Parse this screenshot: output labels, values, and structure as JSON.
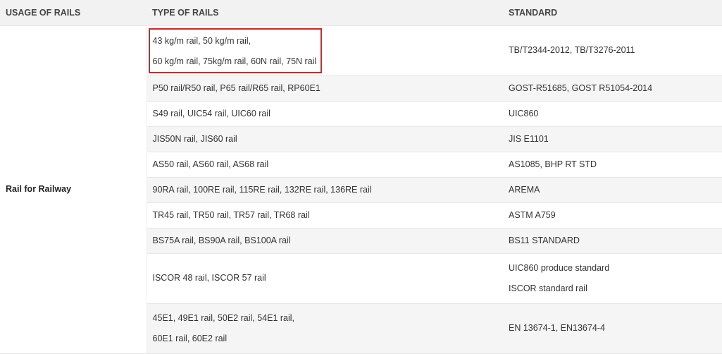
{
  "headers": {
    "usage": "USAGE OF RAILS",
    "type": "TYPE OF RAILS",
    "standard": "STANDARD"
  },
  "usage_label": "Rail for Railway",
  "highlight_color": "#e02020",
  "rows": [
    {
      "type": [
        "43 kg/m rail, 50 kg/m rail,",
        "60 kg/m rail, 75kg/m rail, 60N rail, 75N rail"
      ],
      "standard": [
        "TB/T2344-2012, TB/T3276-2011"
      ]
    },
    {
      "type": [
        "P50 rail/R50 rail, P65 rail/R65 rail, RP60E1"
      ],
      "standard": [
        "GOST-R51685, GOST R51054-2014"
      ]
    },
    {
      "type": [
        "S49 rail, UIC54 rail, UIC60 rail"
      ],
      "standard": [
        "UIC860"
      ]
    },
    {
      "type": [
        "JIS50N rail, JIS60 rail"
      ],
      "standard": [
        "JIS E1101"
      ]
    },
    {
      "type": [
        "AS50 rail, AS60 rail, AS68 rail"
      ],
      "standard": [
        "AS1085, BHP RT STD"
      ]
    },
    {
      "type": [
        "90RA rail, 100RE rail, 115RE rail, 132RE rail, 136RE rail"
      ],
      "standard": [
        "AREMA"
      ]
    },
    {
      "type": [
        "TR45 rail, TR50 rail, TR57 rail, TR68 rail"
      ],
      "standard": [
        "ASTM A759"
      ]
    },
    {
      "type": [
        "BS75A rail, BS90A rail, BS100A rail"
      ],
      "standard": [
        "BS11 STANDARD"
      ]
    },
    {
      "type": [
        "ISCOR 48 rail, ISCOR 57 rail"
      ],
      "standard": [
        "UIC860 produce standard",
        "ISCOR standard rail"
      ]
    },
    {
      "type": [
        "45E1, 49E1 rail, 50E2 rail, 54E1 rail,",
        "60E1 rail, 60E2 rail"
      ],
      "standard": [
        "EN 13674-1, EN13674-4"
      ]
    }
  ]
}
